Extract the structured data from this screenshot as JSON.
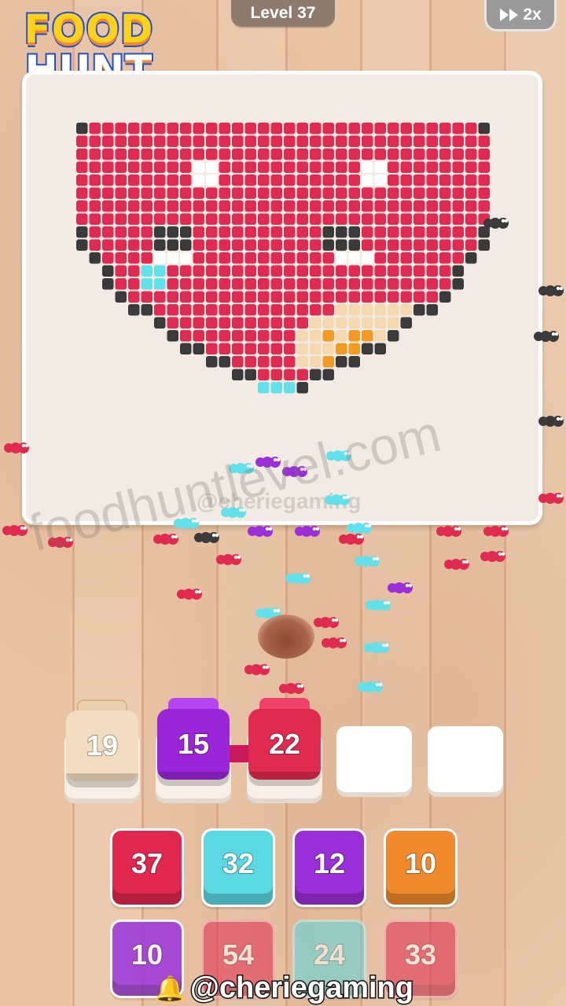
{
  "game": {
    "logo_line1": "FOOD",
    "logo_line2": "HUNT",
    "level_label": "Level 37",
    "speed_label": "2x",
    "watermark_site": "foodhuntlevel.com",
    "watermark_faint": "@cheriegaming"
  },
  "tray": [
    {
      "count": "19",
      "color": "#f3ddc0"
    },
    {
      "count": "15",
      "color": "#9b25d9"
    },
    {
      "count": "22",
      "color": "#e12a4f"
    },
    {
      "count": "",
      "color": "#ffffff"
    },
    {
      "count": "",
      "color": "#ffffff"
    }
  ],
  "queue": [
    {
      "count": "37",
      "color": "#e1274d"
    },
    {
      "count": "32",
      "color": "#5ad9e3"
    },
    {
      "count": "12",
      "color": "#9a2ed8"
    },
    {
      "count": "10",
      "color": "#f08a2c"
    },
    {
      "count": "10",
      "color": "#9a35dd"
    },
    {
      "count": "54",
      "color": "#e1274d"
    },
    {
      "count": "24",
      "color": "#5ad9e3"
    },
    {
      "count": "33",
      "color": "#e1274d"
    }
  ],
  "overlay": {
    "handle": "@cheriegaming",
    "icon": "bell-icon"
  },
  "colors": {
    "red": "#e12a4f",
    "cyan": "#62e1ea",
    "purple": "#9a2ed8",
    "peach": "#f6d8b0",
    "orange": "#f39a22",
    "dark": "#3a3a3a",
    "white": "#ffffff"
  }
}
